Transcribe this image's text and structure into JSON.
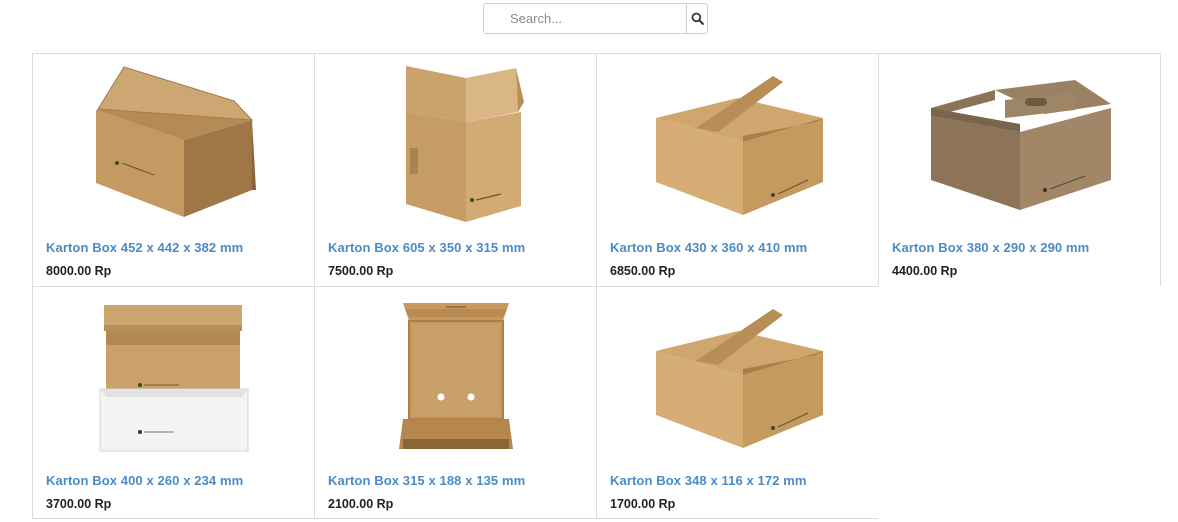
{
  "search": {
    "placeholder": "Search...",
    "button_icon": "search-icon"
  },
  "products": [
    {
      "title": "Karton Box 452 x 442 x 382 mm",
      "price": "8000.00 Rp",
      "image": "open-box-flap-icon"
    },
    {
      "title": "Karton Box 605 x 350 x 315 mm",
      "price": "7500.00 Rp",
      "image": "tall-open-box-icon"
    },
    {
      "title": "Karton Box 430 x 360 x 410 mm",
      "price": "6850.00 Rp",
      "image": "closed-box-icon"
    },
    {
      "title": "Karton Box 380 x 290 x 290 mm",
      "price": "4400.00 Rp",
      "image": "handle-box-icon"
    },
    {
      "title": "Karton Box 400 x 260 x 234 mm",
      "price": "3700.00 Rp",
      "image": "archive-box-icon"
    },
    {
      "title": "Karton Box 315 x 188 x 135 mm",
      "price": "2100.00 Rp",
      "image": "pizza-box-icon"
    },
    {
      "title": "Karton Box 348 x 116 x 172 mm",
      "price": "1700.00 Rp",
      "image": "closed-box-icon"
    }
  ],
  "colors": {
    "link": "#4a8bc8",
    "price": "#222222",
    "cardboard": "#c9a068",
    "border": "#dcdcdc"
  }
}
